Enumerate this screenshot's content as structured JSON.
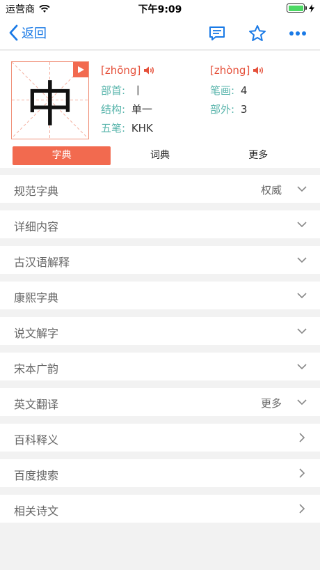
{
  "status_bar": {
    "carrier": "运营商",
    "time": "下午9:09"
  },
  "nav": {
    "back_label": "返回"
  },
  "character": {
    "glyph": "中",
    "pinyin_left": "[zhōng]",
    "pinyin_right": "[zhòng]",
    "radical_label": "部首:",
    "radical_value": "丨",
    "strokes_label": "笔画:",
    "strokes_value": "4",
    "structure_label": "结构:",
    "structure_value": "单一",
    "outside_label": "部外:",
    "outside_value": "3",
    "wubi_label": "五笔:",
    "wubi_value": "KHK"
  },
  "tabs": [
    {
      "label": "字典",
      "active": true
    },
    {
      "label": "词典",
      "active": false
    },
    {
      "label": "更多",
      "active": false
    }
  ],
  "sections": [
    {
      "title": "规范字典",
      "extra": "权威",
      "arrow": "down"
    },
    {
      "title": "详细内容",
      "extra": "",
      "arrow": "down"
    },
    {
      "title": "古汉语解释",
      "extra": "",
      "arrow": "down"
    },
    {
      "title": "康熙字典",
      "extra": "",
      "arrow": "down"
    },
    {
      "title": "说文解字",
      "extra": "",
      "arrow": "down"
    },
    {
      "title": "宋本广韵",
      "extra": "",
      "arrow": "down"
    },
    {
      "title": "英文翻译",
      "extra": "更多",
      "arrow": "down"
    },
    {
      "title": "百科释义",
      "extra": "",
      "arrow": "right"
    },
    {
      "title": "百度搜索",
      "extra": "",
      "arrow": "right"
    },
    {
      "title": "相关诗文",
      "extra": "",
      "arrow": "right"
    }
  ],
  "colors": {
    "accent": "#f26a4f",
    "nav_blue": "#1a7ae6",
    "label_teal": "#5ab5ac",
    "pinyin_red": "#e5503a"
  },
  "icons": [
    "wifi-icon",
    "battery-icon",
    "chevron-left-icon",
    "comment-icon",
    "star-icon",
    "more-icon",
    "play-icon",
    "speaker-icon",
    "chevron-down-icon",
    "chevron-right-icon"
  ]
}
